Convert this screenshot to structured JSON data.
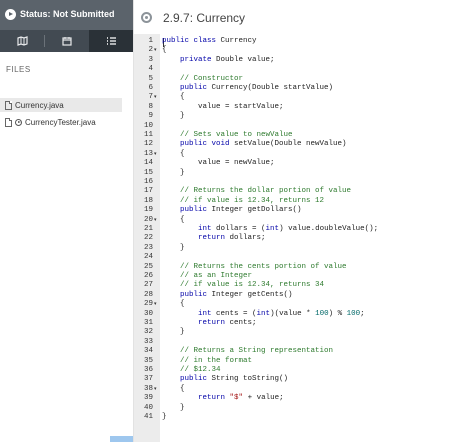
{
  "status": {
    "text": "Status: Not Submitted"
  },
  "sidebar": {
    "tabs": [
      {
        "name": "tab-docs",
        "icon": "map-icon"
      },
      {
        "name": "tab-grades",
        "icon": "calendar-icon"
      },
      {
        "name": "tab-files",
        "icon": "list-icon"
      }
    ],
    "files_label": "FILES",
    "files": [
      {
        "label": "Currency.java",
        "selected": true,
        "runnable": false
      },
      {
        "label": "CurrencyTester.java",
        "selected": false,
        "runnable": true
      }
    ]
  },
  "header": {
    "title": "2.9.7: Currency",
    "icon": "settings-circle-icon"
  },
  "editor": {
    "lines": [
      {
        "n": "1",
        "fold": false,
        "tokens": [
          [
            "kw",
            "public class"
          ],
          [
            "pl",
            " Currency"
          ]
        ]
      },
      {
        "n": "2",
        "fold": true,
        "tokens": [
          [
            "pl",
            "{"
          ]
        ]
      },
      {
        "n": "3",
        "fold": false,
        "tokens": [
          [
            "pl",
            "    "
          ],
          [
            "kw",
            "private"
          ],
          [
            "pl",
            " Double value;"
          ]
        ]
      },
      {
        "n": "4",
        "fold": false,
        "tokens": []
      },
      {
        "n": "5",
        "fold": false,
        "tokens": [
          [
            "pl",
            "    "
          ],
          [
            "cm",
            "// Constructor"
          ]
        ]
      },
      {
        "n": "6",
        "fold": false,
        "tokens": [
          [
            "pl",
            "    "
          ],
          [
            "kw",
            "public"
          ],
          [
            "pl",
            " Currency(Double startValue)"
          ]
        ]
      },
      {
        "n": "7",
        "fold": true,
        "tokens": [
          [
            "pl",
            "    {"
          ]
        ]
      },
      {
        "n": "8",
        "fold": false,
        "tokens": [
          [
            "pl",
            "        value = startValue;"
          ]
        ]
      },
      {
        "n": "9",
        "fold": false,
        "tokens": [
          [
            "pl",
            "    }"
          ]
        ]
      },
      {
        "n": "10",
        "fold": false,
        "tokens": []
      },
      {
        "n": "11",
        "fold": false,
        "tokens": [
          [
            "pl",
            "    "
          ],
          [
            "cm",
            "// Sets value to newValue"
          ]
        ]
      },
      {
        "n": "12",
        "fold": false,
        "tokens": [
          [
            "pl",
            "    "
          ],
          [
            "kw",
            "public void"
          ],
          [
            "pl",
            " setValue(Double newValue)"
          ]
        ]
      },
      {
        "n": "13",
        "fold": true,
        "tokens": [
          [
            "pl",
            "    {"
          ]
        ]
      },
      {
        "n": "14",
        "fold": false,
        "tokens": [
          [
            "pl",
            "        value = newValue;"
          ]
        ]
      },
      {
        "n": "15",
        "fold": false,
        "tokens": [
          [
            "pl",
            "    }"
          ]
        ]
      },
      {
        "n": "16",
        "fold": false,
        "tokens": []
      },
      {
        "n": "17",
        "fold": false,
        "tokens": [
          [
            "pl",
            "    "
          ],
          [
            "cm",
            "// Returns the dollar portion of value"
          ]
        ]
      },
      {
        "n": "18",
        "fold": false,
        "tokens": [
          [
            "pl",
            "    "
          ],
          [
            "cm",
            "// if value is 12.34, returns 12"
          ]
        ]
      },
      {
        "n": "19",
        "fold": false,
        "tokens": [
          [
            "pl",
            "    "
          ],
          [
            "kw",
            "public"
          ],
          [
            "pl",
            " Integer getDollars()"
          ]
        ]
      },
      {
        "n": "20",
        "fold": true,
        "tokens": [
          [
            "pl",
            "    {"
          ]
        ]
      },
      {
        "n": "21",
        "fold": false,
        "tokens": [
          [
            "pl",
            "        "
          ],
          [
            "kw",
            "int"
          ],
          [
            "pl",
            " dollars = ("
          ],
          [
            "kw",
            "int"
          ],
          [
            "pl",
            ") value.doubleValue();"
          ]
        ]
      },
      {
        "n": "22",
        "fold": false,
        "tokens": [
          [
            "pl",
            "        "
          ],
          [
            "kw",
            "return"
          ],
          [
            "pl",
            " dollars;"
          ]
        ]
      },
      {
        "n": "23",
        "fold": false,
        "tokens": [
          [
            "pl",
            "    }"
          ]
        ]
      },
      {
        "n": "24",
        "fold": false,
        "tokens": []
      },
      {
        "n": "25",
        "fold": false,
        "tokens": [
          [
            "pl",
            "    "
          ],
          [
            "cm",
            "// Returns the cents portion of value"
          ]
        ]
      },
      {
        "n": "26",
        "fold": false,
        "tokens": [
          [
            "pl",
            "    "
          ],
          [
            "cm",
            "// as an Integer"
          ]
        ]
      },
      {
        "n": "27",
        "fold": false,
        "tokens": [
          [
            "pl",
            "    "
          ],
          [
            "cm",
            "// if value is 12.34, returns 34"
          ]
        ]
      },
      {
        "n": "28",
        "fold": false,
        "tokens": [
          [
            "pl",
            "    "
          ],
          [
            "kw",
            "public"
          ],
          [
            "pl",
            " Integer getCents()"
          ]
        ]
      },
      {
        "n": "29",
        "fold": true,
        "tokens": [
          [
            "pl",
            "    {"
          ]
        ]
      },
      {
        "n": "30",
        "fold": false,
        "tokens": [
          [
            "pl",
            "        "
          ],
          [
            "kw",
            "int"
          ],
          [
            "pl",
            " cents = ("
          ],
          [
            "kw",
            "int"
          ],
          [
            "pl",
            ")(value * "
          ],
          [
            "num",
            "100"
          ],
          [
            "pl",
            ") % "
          ],
          [
            "num",
            "100"
          ],
          [
            "pl",
            ";"
          ]
        ]
      },
      {
        "n": "31",
        "fold": false,
        "tokens": [
          [
            "pl",
            "        "
          ],
          [
            "kw",
            "return"
          ],
          [
            "pl",
            " cents;"
          ]
        ]
      },
      {
        "n": "32",
        "fold": false,
        "tokens": [
          [
            "pl",
            "    }"
          ]
        ]
      },
      {
        "n": "33",
        "fold": false,
        "tokens": []
      },
      {
        "n": "34",
        "fold": false,
        "tokens": [
          [
            "pl",
            "    "
          ],
          [
            "cm",
            "// Returns a String representation"
          ]
        ]
      },
      {
        "n": "35",
        "fold": false,
        "tokens": [
          [
            "pl",
            "    "
          ],
          [
            "cm",
            "// in the format"
          ]
        ]
      },
      {
        "n": "36",
        "fold": false,
        "tokens": [
          [
            "pl",
            "    "
          ],
          [
            "cm",
            "// $12.34"
          ]
        ]
      },
      {
        "n": "37",
        "fold": false,
        "tokens": [
          [
            "pl",
            "    "
          ],
          [
            "kw",
            "public"
          ],
          [
            "pl",
            " String toString()"
          ]
        ]
      },
      {
        "n": "38",
        "fold": true,
        "tokens": [
          [
            "pl",
            "    {"
          ]
        ]
      },
      {
        "n": "39",
        "fold": false,
        "tokens": [
          [
            "pl",
            "        "
          ],
          [
            "kw",
            "return"
          ],
          [
            "pl",
            " "
          ],
          [
            "str",
            "\"$\""
          ],
          [
            "pl",
            " + value;"
          ]
        ]
      },
      {
        "n": "40",
        "fold": false,
        "tokens": [
          [
            "pl",
            "    }"
          ]
        ]
      },
      {
        "n": "41",
        "fold": false,
        "tokens": [
          [
            "pl",
            "}"
          ]
        ]
      }
    ]
  },
  "colors": {
    "status_bg": "#5b636b",
    "tab_bar_bg": "#424a52",
    "gutter_bg": "#ececec",
    "keyword": "#0000a8",
    "comment": "#2d7a2d",
    "number": "#006868",
    "string": "#a41515"
  }
}
